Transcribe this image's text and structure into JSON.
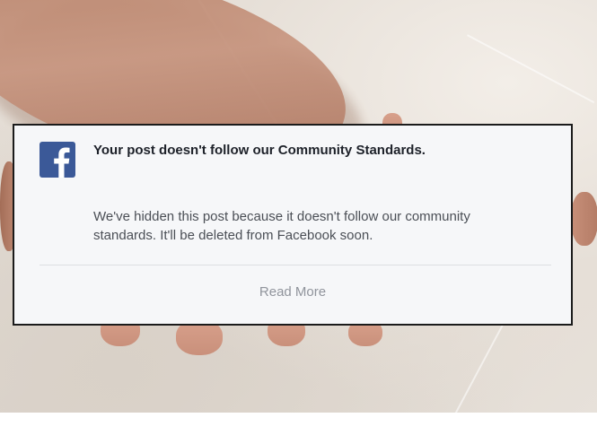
{
  "notification": {
    "title": "Your post doesn't follow our Community Standards.",
    "body_line1": "We've hidden this post because it doesn't follow our community",
    "body_line2": "standards. It'll be deleted from Facebook soon.",
    "action_label": "Read More",
    "logo_icon": "facebook-logo-icon",
    "colors": {
      "brand": "#3b5998",
      "title": "#1d2129",
      "body": "#4b4f56",
      "action": "#90949c",
      "card_bg": "#f6f7f9"
    }
  }
}
